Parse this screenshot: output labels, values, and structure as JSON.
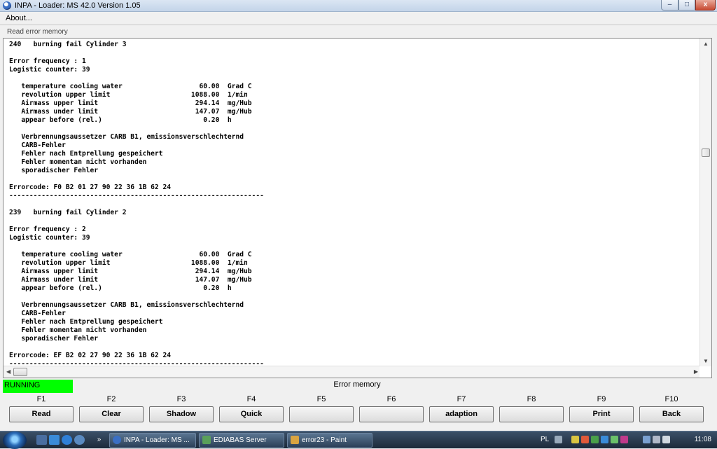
{
  "window": {
    "title": "INPA - Loader:  MS 42.0 Version 1.05",
    "controls": {
      "minimize": "–",
      "maximize": "□",
      "close": "x"
    }
  },
  "menu": {
    "about": "About..."
  },
  "content": {
    "section_label": "Read error memory",
    "log_lines": [
      "240   burning fail Cylinder 3",
      "",
      "Error frequency : 1",
      "Logistic counter: 39",
      "",
      "   temperature cooling water                   60.00  Grad C",
      "   revolution upper limit                    1088.00  1/min",
      "   Airmass upper limit                        294.14  mg/Hub",
      "   Airmass under limit                        147.07  mg/Hub",
      "   appear before (rel.)                         0.20  h",
      "",
      "   Verbrennungsaussetzer CARB B1, emissionsverschlechternd",
      "   CARB-Fehler",
      "   Fehler nach Entprellung gespeichert",
      "   Fehler momentan nicht vorhanden",
      "   sporadischer Fehler",
      "",
      "Errorcode: F0 B2 01 27 90 22 36 1B 62 24",
      "---------------------------------------------------------------",
      "",
      "239   burning fail Cylinder 2",
      "",
      "Error frequency : 2",
      "Logistic counter: 39",
      "",
      "   temperature cooling water                   60.00  Grad C",
      "   revolution upper limit                    1088.00  1/min",
      "   Airmass upper limit                        294.14  mg/Hub",
      "   Airmass under limit                        147.07  mg/Hub",
      "   appear before (rel.)                         0.20  h",
      "",
      "   Verbrennungsaussetzer CARB B1, emissionsverschlechternd",
      "   CARB-Fehler",
      "   Fehler nach Entprellung gespeichert",
      "   Fehler momentan nicht vorhanden",
      "   sporadischer Fehler",
      "",
      "Errorcode: EF B2 02 27 90 22 36 1B 62 24",
      "---------------------------------------------------------------"
    ]
  },
  "status": {
    "state": "RUNNING",
    "state_color": "#00ff00",
    "caption": "Error memory"
  },
  "fkeys": [
    {
      "key": "F1",
      "label": "Read"
    },
    {
      "key": "F2",
      "label": "Clear"
    },
    {
      "key": "F3",
      "label": "Shadow"
    },
    {
      "key": "F4",
      "label": "Quick"
    },
    {
      "key": "F5",
      "label": ""
    },
    {
      "key": "F6",
      "label": ""
    },
    {
      "key": "F7",
      "label": "adaption"
    },
    {
      "key": "F8",
      "label": ""
    },
    {
      "key": "F9",
      "label": "Print"
    },
    {
      "key": "F10",
      "label": "Back"
    }
  ],
  "taskbar": {
    "tasks": [
      {
        "label": "INPA - Loader:  MS ...",
        "icon": "inpa-icon"
      },
      {
        "label": "EDIABAS Server",
        "icon": "ediabas-icon"
      },
      {
        "label": "error23 - Paint",
        "icon": "paint-icon"
      }
    ],
    "quicklaunch_more": "»",
    "language": "PL",
    "clock": "11:08"
  }
}
